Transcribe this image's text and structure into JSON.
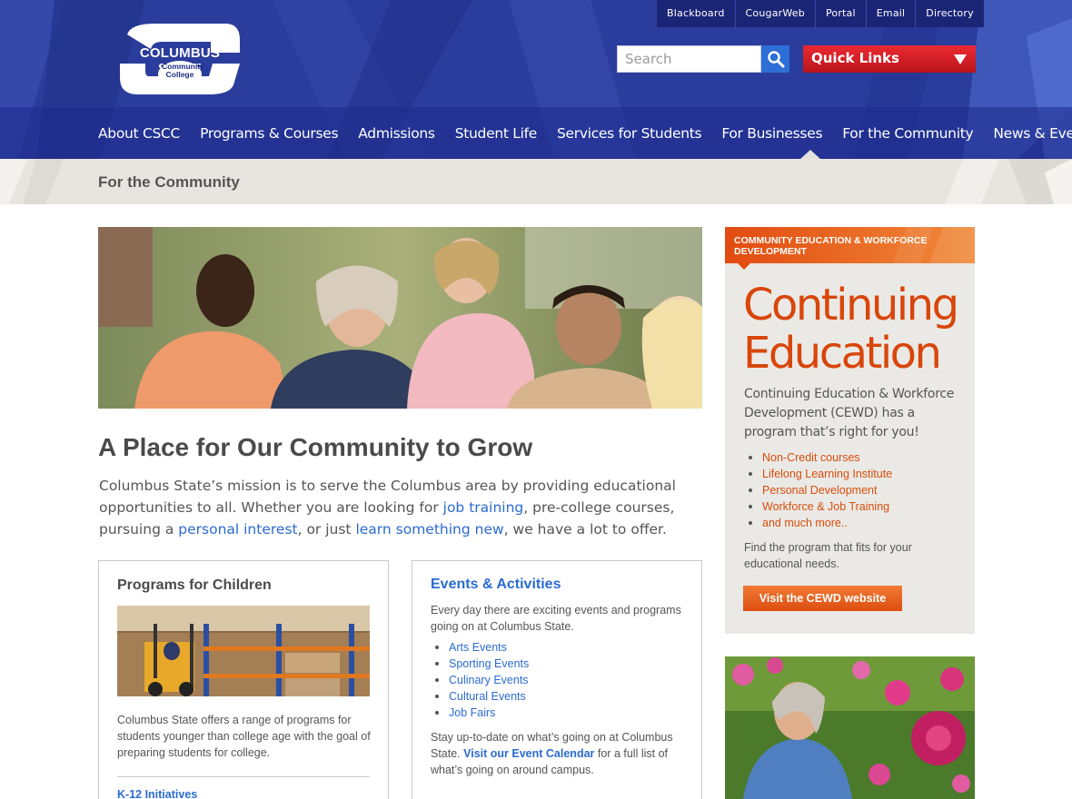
{
  "logo": {
    "name": "COLUMBUS STATE",
    "sub": "Community College"
  },
  "utility_links": [
    "Blackboard",
    "CougarWeb",
    "Portal",
    "Email",
    "Directory"
  ],
  "search": {
    "placeholder": "Search"
  },
  "quick_links": {
    "label": "Quick Links"
  },
  "main_nav": [
    "About CSCC",
    "Programs & Courses",
    "Admissions",
    "Student Life",
    "Services for Students",
    "For Businesses",
    "For the Community",
    "News & Events"
  ],
  "subbar": {
    "title": "For the Community"
  },
  "content": {
    "heading": "A Place for Our Community to Grow",
    "intro": {
      "part1": "Columbus State’s mission is to serve the Columbus area by providing educational opportunities to all. Whether you are looking for ",
      "link1": "job training",
      "part2": ", pre-college courses, pursuing a ",
      "link2": "personal interest",
      "part3": ", or just ",
      "link3": "learn something new",
      "part4": ", we have a lot to offer."
    }
  },
  "card_children": {
    "title": "Programs for Children",
    "text": "Columbus State offers a range of programs for students younger than college age with the goal of preparing students for college.",
    "link": "K-12 Initiatives"
  },
  "card_events": {
    "title": "Events & Activities",
    "intro": "Every day there are exciting events and programs going on at Columbus State.",
    "items": [
      "Arts Events",
      "Sporting Events",
      "Culinary Events",
      "Cultural Events",
      "Job Fairs"
    ],
    "outro_before": "Stay up-to-date on what’s going on at Columbus State. ",
    "outro_link": "Visit our Event Calendar",
    "outro_after": " for a full list of what’s going on around campus."
  },
  "sidebar": {
    "banner": "COMMUNITY EDUCATION & WORKFORCE DEVELOPMENT",
    "big_line1": "Continuing",
    "big_line2": "Education",
    "description": "Continuing Education & Workforce Development (CEWD) has a program that’s right for you!",
    "items": [
      "Non-Credit courses",
      "Lifelong Learning Institute",
      "Personal Development",
      "Workforce & Job Training",
      "and much more.."
    ],
    "find_text": "Find the program that fits for your educational needs.",
    "button": "Visit the CEWD website"
  },
  "colors": {
    "header_blue": "#2c3f9e",
    "link_blue": "#2b6bd2",
    "accent_orange": "#d8460b",
    "quick_red": "#d81f27"
  },
  "icons": {
    "search": "search-icon",
    "dropdown": "triangle-down-icon"
  }
}
